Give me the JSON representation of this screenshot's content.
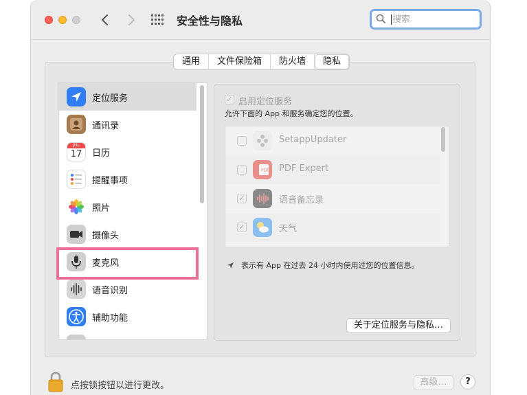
{
  "window": {
    "title": "安全性与隐私",
    "search": {
      "placeholder": "搜索",
      "value": ""
    }
  },
  "tabs": [
    {
      "label": "通用",
      "active": false
    },
    {
      "label": "文件保险箱",
      "active": false
    },
    {
      "label": "防火墙",
      "active": false
    },
    {
      "label": "隐私",
      "active": true
    }
  ],
  "sidebar": {
    "items": [
      {
        "label": "定位服务",
        "icon": "location-arrow-icon",
        "selected": true
      },
      {
        "label": "通讯录",
        "icon": "contacts-icon",
        "selected": false
      },
      {
        "label": "日历",
        "icon": "calendar-icon",
        "selected": false,
        "icon_text": {
          "month": "JUL",
          "day": "17"
        }
      },
      {
        "label": "提醒事项",
        "icon": "reminders-icon",
        "selected": false
      },
      {
        "label": "照片",
        "icon": "photos-icon",
        "selected": false
      },
      {
        "label": "摄像头",
        "icon": "camera-icon",
        "selected": false
      },
      {
        "label": "麦克风",
        "icon": "microphone-icon",
        "selected": false
      },
      {
        "label": "语音识别",
        "icon": "speech-recognition-icon",
        "selected": false
      },
      {
        "label": "辅助功能",
        "icon": "accessibility-icon",
        "selected": false
      }
    ]
  },
  "location_panel": {
    "enable_label": "启用定位服务",
    "enable_checked": true,
    "allow_text": "允许下面的 App 和服务确定您的位置。",
    "apps": [
      {
        "name": "SetappUpdater",
        "checked": false,
        "icon": "setapp-icon"
      },
      {
        "name": "PDF Expert",
        "checked": false,
        "icon": "pdf-expert-icon"
      },
      {
        "name": "语音备忘录",
        "checked": true,
        "icon": "voice-memos-icon"
      },
      {
        "name": "天气",
        "checked": true,
        "icon": "weather-icon"
      }
    ],
    "usage_note": "表示有 App 在过去 24 小时内使用过您的位置信息。",
    "about_button": "关于定位服务与隐私…"
  },
  "footer": {
    "lock_text": "点按锁按钮以进行更改。",
    "advanced_button": "高级…",
    "help_button": "?"
  },
  "colors": {
    "highlight": "#ec6f9a",
    "search_focus": "#7aa9e6",
    "location_icon": "#2f7ef6"
  }
}
